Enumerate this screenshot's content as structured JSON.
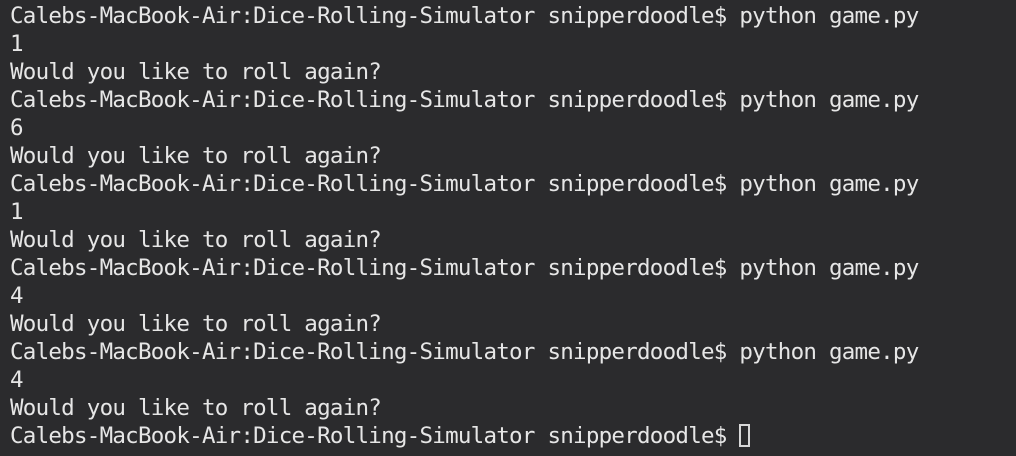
{
  "terminal": {
    "lines": [
      "Calebs-MacBook-Air:Dice-Rolling-Simulator snipperdoodle$ python game.py",
      "1",
      "Would you like to roll again?",
      "Calebs-MacBook-Air:Dice-Rolling-Simulator snipperdoodle$ python game.py",
      "6",
      "Would you like to roll again?",
      "Calebs-MacBook-Air:Dice-Rolling-Simulator snipperdoodle$ python game.py",
      "1",
      "Would you like to roll again?",
      "Calebs-MacBook-Air:Dice-Rolling-Simulator snipperdoodle$ python game.py",
      "4",
      "Would you like to roll again?",
      "Calebs-MacBook-Air:Dice-Rolling-Simulator snipperdoodle$ python game.py",
      "4",
      "Would you like to roll again?"
    ],
    "prompt": "Calebs-MacBook-Air:Dice-Rolling-Simulator snipperdoodle$",
    "background_color": "#2b2b2d",
    "text_color": "#e6e6e6"
  }
}
